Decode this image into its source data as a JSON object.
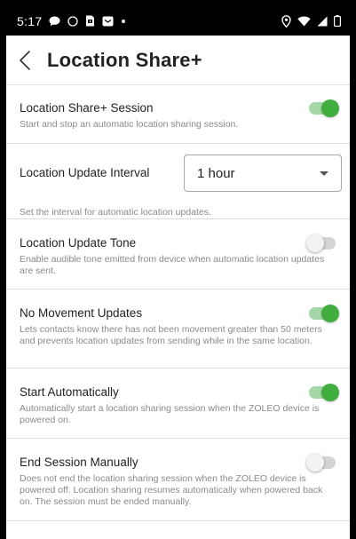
{
  "status_bar": {
    "time": "5:17",
    "icons_left": [
      "chat-bubble-icon",
      "circle-icon",
      "sim-icon",
      "message-icon",
      "dot-icon"
    ],
    "icons_right": [
      "location-pin-icon",
      "wifi-icon",
      "signal-icon",
      "battery-icon"
    ]
  },
  "header": {
    "title": "Location Share+",
    "back_icon": "chevron-left-icon"
  },
  "colors": {
    "toggle_on": "#3fae3f",
    "toggle_on_track": "#a5d6a7",
    "toggle_off_track": "#d4d4d4"
  },
  "settings": [
    {
      "title": "Location Share+ Session",
      "description": "Start and stop an automatic location sharing session.",
      "enabled": true
    },
    {
      "title": "Location Update Interval",
      "description": "Set the interval for automatic location updates.",
      "selected": "1 hour"
    },
    {
      "title": "Location Update Tone",
      "description": "Enable audible tone emitted from device when automatic location updates are sent.",
      "enabled": false
    },
    {
      "title": "No Movement Updates",
      "description": "Lets contacts know there has not been movement greater than 50 meters and prevents location updates from sending while in the same location.",
      "enabled": true
    },
    {
      "title": "Start Automatically",
      "description": "Automatically start a location sharing session when the ZOLEO device is powered on.",
      "enabled": true
    },
    {
      "title": "End Session Manually",
      "description": "Does not end the location sharing session when the ZOLEO device is powered off. Location sharing resumes automatically when powered back on. The session must be ended manually.",
      "enabled": false
    }
  ]
}
